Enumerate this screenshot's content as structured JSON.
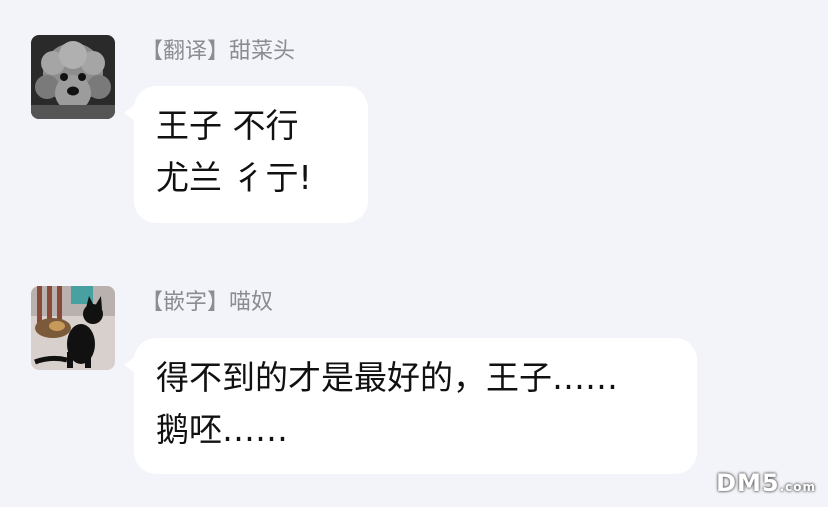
{
  "messages": [
    {
      "avatar": "poodle-dog-photo",
      "sender": "【翻译】甜菜头",
      "lines": [
        "王子 不行",
        "尤兰 彳亍!"
      ]
    },
    {
      "avatar": "black-cat-photo",
      "sender": "【嵌字】喵奴",
      "lines": [
        "得不到的才是最好的，王子……",
        "鹅呸……"
      ]
    }
  ],
  "watermark": {
    "brand": "DM5",
    "suffix": ".com"
  },
  "colors": {
    "background": "#f3f4f9",
    "bubble": "#ffffff",
    "sender": "#8b8d93",
    "text": "#111111"
  }
}
